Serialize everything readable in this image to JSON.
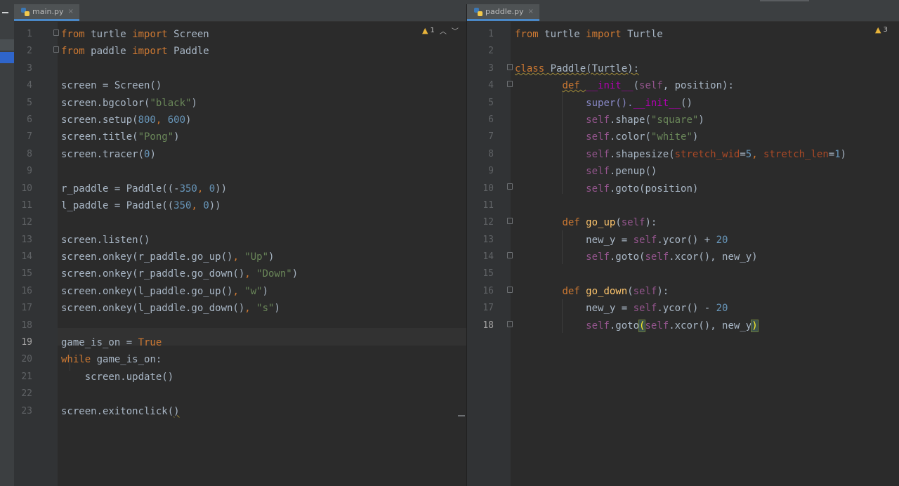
{
  "left_editor": {
    "tab": {
      "label": "main.py",
      "close": "×"
    },
    "warning": {
      "count": "1"
    },
    "current_line": "19",
    "lines": [
      {
        "n": "1"
      },
      {
        "n": "2"
      },
      {
        "n": "3"
      },
      {
        "n": "4"
      },
      {
        "n": "5"
      },
      {
        "n": "6"
      },
      {
        "n": "7"
      },
      {
        "n": "8"
      },
      {
        "n": "9"
      },
      {
        "n": "10"
      },
      {
        "n": "11"
      },
      {
        "n": "12"
      },
      {
        "n": "13"
      },
      {
        "n": "14"
      },
      {
        "n": "15"
      },
      {
        "n": "16"
      },
      {
        "n": "17"
      },
      {
        "n": "18"
      },
      {
        "n": "19"
      },
      {
        "n": "20"
      },
      {
        "n": "21"
      },
      {
        "n": "22"
      },
      {
        "n": "23"
      }
    ],
    "code": {
      "l1": {
        "a": "from",
        "b": " turtle ",
        "c": "import",
        "d": " Screen"
      },
      "l2": {
        "a": "from",
        "b": " paddle ",
        "c": "import",
        "d": " Paddle"
      },
      "l4": "screen = Screen()",
      "l5": {
        "a": "screen.bgcolor(",
        "s": "\"black\"",
        "b": ")"
      },
      "l6": {
        "a": "screen.setup(",
        "n1": "800",
        "c": ", ",
        "n2": "600",
        "b": ")"
      },
      "l7": {
        "a": "screen.title(",
        "s": "\"Pong\"",
        "b": ")"
      },
      "l8": {
        "a": "screen.tracer(",
        "n": "0",
        "b": ")"
      },
      "l10": {
        "a": "r_paddle = Paddle((-",
        "n1": "350",
        "c": ", ",
        "n2": "0",
        "b": "))"
      },
      "l11": {
        "a": "l_paddle = Paddle((",
        "n1": "350",
        "c": ", ",
        "n2": "0",
        "b": "))"
      },
      "l13": "screen.listen()",
      "l14": {
        "a": "screen.onkey(r_paddle.go_up()",
        ",": ", ",
        "s": "\"Up\"",
        "b": ")"
      },
      "l15": {
        "a": "screen.onkey(r_paddle.go_down()",
        ",": ", ",
        "s": "\"Down\"",
        "b": ")"
      },
      "l16": {
        "a": "screen.onkey(l_paddle.go_up()",
        ",": ", ",
        "s": "\"w\"",
        "b": ")"
      },
      "l17": {
        "a": "screen.onkey(l_paddle.go_down()",
        ",": ", ",
        "s": "\"s\"",
        "b": ")"
      },
      "l19": {
        "a": "game_is_on = ",
        "k": "True"
      },
      "l20": {
        "k": "while",
        "a": " game_is_on:"
      },
      "l21": "    screen.update()",
      "l23": {
        "a": "screen.exitonclick(",
        "b": ")"
      }
    }
  },
  "right_editor": {
    "tab": {
      "label": "paddle.py",
      "close": "×"
    },
    "warning": {
      "count": "3"
    },
    "lines": [
      {
        "n": "1"
      },
      {
        "n": "2"
      },
      {
        "n": "3"
      },
      {
        "n": "4"
      },
      {
        "n": "5"
      },
      {
        "n": "6"
      },
      {
        "n": "7"
      },
      {
        "n": "8"
      },
      {
        "n": "9"
      },
      {
        "n": "10"
      },
      {
        "n": "11"
      },
      {
        "n": "12"
      },
      {
        "n": "13"
      },
      {
        "n": "14"
      },
      {
        "n": "15"
      },
      {
        "n": "16"
      },
      {
        "n": "17"
      },
      {
        "n": "18"
      }
    ],
    "code": {
      "l1": {
        "a": "from",
        "b": " turtle ",
        "c": "import",
        "d": " Turtle"
      },
      "l3": {
        "k": "class",
        "a": " Paddle(Turtle):"
      },
      "l4": {
        "ind": "        ",
        "k": "def ",
        "d": "__init__",
        "a": "(",
        "s": "self",
        "b": ", position):"
      },
      "l5": {
        "ind": "            ",
        "a": "super().",
        "d": "__init__",
        "b": "()"
      },
      "l6": {
        "ind": "            ",
        "s": "self",
        "a": ".shape(",
        "str": "\"square\"",
        "b": ")"
      },
      "l7": {
        "ind": "            ",
        "s": "self",
        "a": ".color(",
        "str": "\"white\"",
        "b": ")"
      },
      "l8": {
        "ind": "            ",
        "s": "self",
        "a": ".shapesize(",
        "p1": "stretch_wid",
        "e1": "=",
        "n1": "5",
        "c": ", ",
        "p2": "stretch_len",
        "e2": "=",
        "n2": "1",
        "b": ")"
      },
      "l9": {
        "ind": "            ",
        "s": "self",
        "a": ".penup()"
      },
      "l10": {
        "ind": "            ",
        "s": "self",
        "a": ".goto(position)"
      },
      "l12": {
        "ind": "        ",
        "k": "def ",
        "f": "go_up",
        "a": "(",
        "s": "self",
        "b": "):"
      },
      "l13": {
        "ind": "            ",
        "a": "new_y = ",
        "s": "self",
        "b": ".ycor() + ",
        "n": "20"
      },
      "l14": {
        "ind": "            ",
        "s": "self",
        "a": ".goto(",
        "s2": "self",
        "b": ".xcor(), new_y)"
      },
      "l16": {
        "ind": "        ",
        "k": "def ",
        "f": "go_down",
        "a": "(",
        "s": "self",
        "b": "):"
      },
      "l17": {
        "ind": "            ",
        "a": "new_y = ",
        "s": "self",
        "b": ".ycor() - ",
        "n": "20"
      },
      "l18": {
        "ind": "            ",
        "s": "self",
        "a": ".goto",
        "p": "(",
        "s2": "self",
        "b": ".xcor(), new_y",
        "q": ")"
      }
    }
  }
}
